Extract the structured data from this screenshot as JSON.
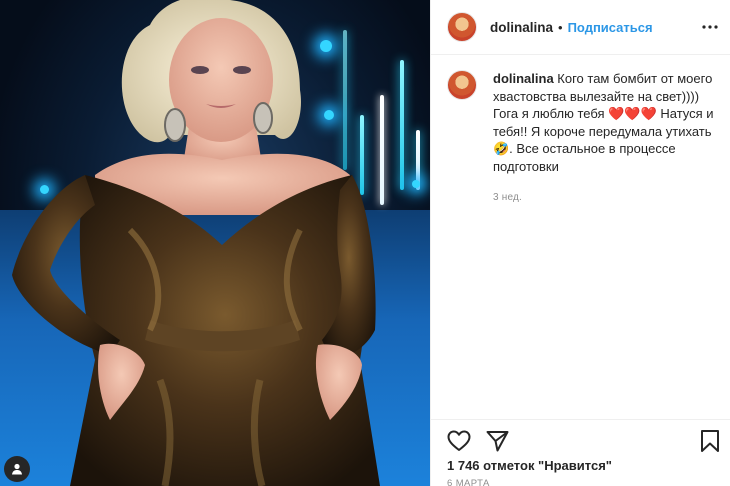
{
  "post": {
    "username": "dolinalina",
    "follow_label": "Подписаться",
    "separator": "•",
    "caption_text": "Кого там бомбит от моего хвастовства вылезайте на свет)))) Гога я люблю тебя ❤️❤️❤️ Натуся и тебя!! Я короче передумала утихать🤣. Все остальное в процессе подготовки",
    "caption_time": "3 нед.",
    "likes_label": "1 746 отметок \"Нравится\"",
    "date_label": "6 МАРТА"
  },
  "icons": {
    "more": "more-icon",
    "like": "heart-icon",
    "share": "paper-plane-icon",
    "save": "bookmark-icon",
    "badge": "user-tag-icon"
  },
  "colors": {
    "link": "#2c97e6",
    "text": "#262626",
    "muted": "#8e8e8e",
    "divider": "#efefef"
  }
}
